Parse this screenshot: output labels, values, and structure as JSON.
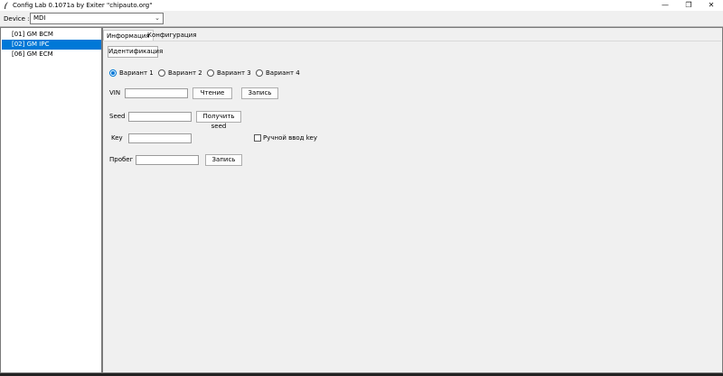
{
  "window": {
    "title": "Config Lab 0.1071a by Exiter \"chipauto.org\"",
    "minimize": "—",
    "maximize": "❐",
    "close": "✕"
  },
  "device": {
    "label": "Device :",
    "selected": "MDI"
  },
  "modules": [
    {
      "label": "[01] GM BCM",
      "selected": false
    },
    {
      "label": "[02] GM IPC",
      "selected": true
    },
    {
      "label": "[06] GM ECM",
      "selected": false
    }
  ],
  "tabs": [
    {
      "label": "Информация",
      "active": true
    },
    {
      "label": "Конфигурация",
      "active": false
    }
  ],
  "identify_button": "Идентификация",
  "variants": [
    {
      "label": "Вариант 1",
      "checked": true
    },
    {
      "label": "Вариант 2",
      "checked": false
    },
    {
      "label": "Вариант 3",
      "checked": false
    },
    {
      "label": "Вариант 4",
      "checked": false
    }
  ],
  "vin": {
    "label": "VIN",
    "value": "",
    "read_button": "Чтение",
    "write_button": "Запись"
  },
  "seed": {
    "label": "Seed",
    "value": "",
    "get_button": "Получить seed"
  },
  "key": {
    "label": "Key",
    "value": "",
    "manual_label": "Ручной ввод key",
    "manual_checked": false
  },
  "mileage": {
    "label": "Пробег",
    "value": "",
    "write_button": "Запись"
  },
  "colors": {
    "selection": "#0078d7"
  }
}
